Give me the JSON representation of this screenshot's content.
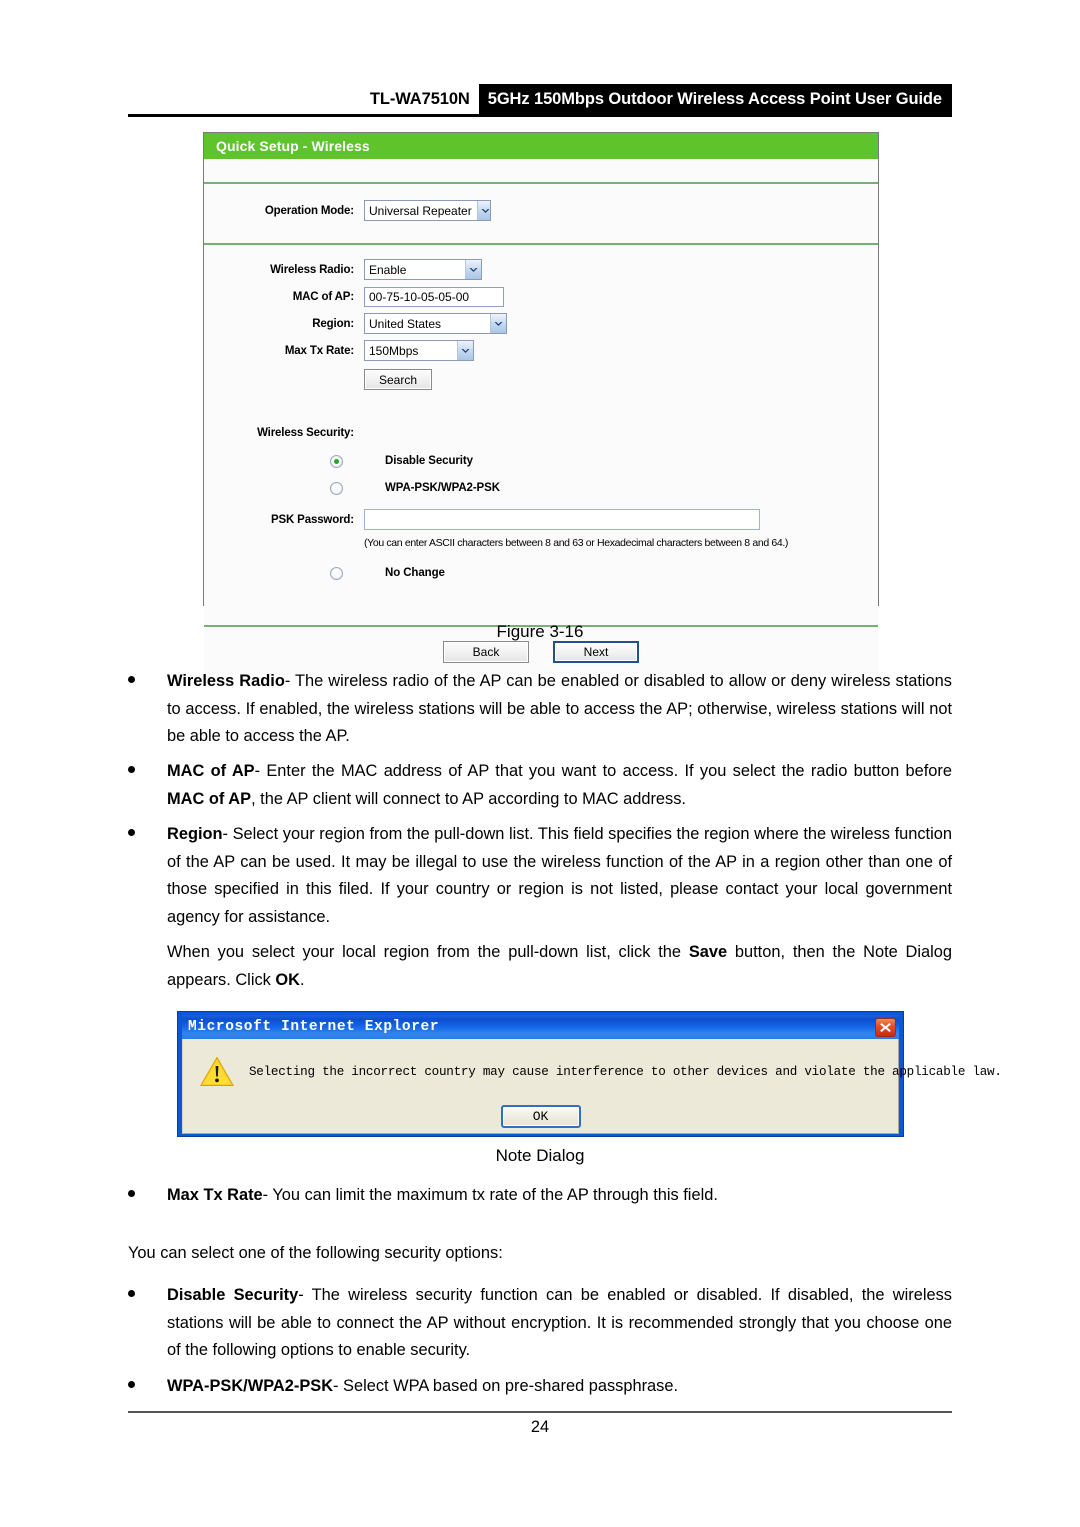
{
  "header": {
    "model": "TL-WA7510N",
    "title": "5GHz 150Mbps Outdoor Wireless Access Point User Guide"
  },
  "config_panel": {
    "panel_title": "Quick Setup - Wireless",
    "accent_green": "#5fc32c",
    "fields": {
      "operation_mode": {
        "label": "Operation Mode:",
        "value": "Universal Repeater",
        "icon": "chevron-down-icon"
      },
      "wireless_radio": {
        "label": "Wireless Radio:",
        "value": "Enable",
        "icon": "chevron-down-icon"
      },
      "mac_of_ap": {
        "label": "MAC of AP:",
        "value": "00-75-10-05-05-00"
      },
      "region": {
        "label": "Region:",
        "value": "United States",
        "icon": "chevron-down-icon"
      },
      "max_tx_rate": {
        "label": "Max Tx Rate:",
        "value": "150Mbps",
        "icon": "chevron-down-icon"
      }
    },
    "search_button": "Search",
    "wireless_security": {
      "label": "Wireless Security:",
      "options": [
        {
          "label": "Disable Security",
          "selected": true
        },
        {
          "label": "WPA-PSK/WPA2-PSK",
          "selected": false
        },
        {
          "label": "No Change",
          "selected": false
        }
      ],
      "psk_password_label": "PSK Password:",
      "psk_password_value": "",
      "psk_hint": "(You can enter ASCII characters between 8 and 63 or Hexadecimal characters between 8 and 64.)"
    },
    "back_button": "Back",
    "next_button": "Next"
  },
  "captions": {
    "figure": "Figure 3-16",
    "note_dialog": "Note Dialog"
  },
  "body": {
    "bullet_wireless_radio": {
      "term": "Wireless Radio",
      "text": "- The wireless radio of the AP can be enabled or disabled to allow or deny wireless stations to access. If enabled, the wireless stations will be able to access the AP; otherwise, wireless stations will not be able to access the AP."
    },
    "bullet_mac_of_ap": {
      "term": "MAC of AP",
      "text_a": "- Enter the MAC address of AP that you want to access. If you select the radio button before ",
      "term_b": "MAC of AP",
      "text_b": ", the AP client will connect to AP according to MAC address."
    },
    "bullet_region": {
      "term": "Region",
      "text": "- Select your region from the pull-down list. This field specifies the region where the wireless function of the AP can be used. It may be illegal to use the wireless function of the AP in a region other than one of those specified in this filed. If your country or region is not listed, please contact your local government agency for assistance."
    },
    "para_save": {
      "text_a": "When you select your local region from the pull-down list, click the ",
      "term_save": "Save",
      "text_b": " button, then the Note Dialog appears. Click ",
      "term_ok": "OK",
      "text_c": "."
    },
    "bullet_max_tx_rate": {
      "term": "Max Tx Rate",
      "text": "- You can limit the maximum tx rate of the AP through this field."
    },
    "para_security_options": "You can select one of the following security options:",
    "bullet_disable_security": {
      "term": "Disable Security",
      "text": "- The wireless security function can be enabled or disabled. If disabled, the wireless stations will be able to connect the AP without encryption. It is recommended strongly that you choose one of the following options to enable security."
    },
    "bullet_wpa_psk": {
      "term": "WPA-PSK/WPA2-PSK",
      "text": "- Select WPA based on pre-shared passphrase."
    }
  },
  "ie_dialog": {
    "title": "Microsoft Internet Explorer",
    "close_icon": "close-icon",
    "warning_icon": "warning-triangle-icon",
    "message": "Selecting the incorrect country may cause interference to other devices and violate the applicable law.",
    "ok_button": "OK"
  },
  "footer": {
    "page_number": "24"
  }
}
